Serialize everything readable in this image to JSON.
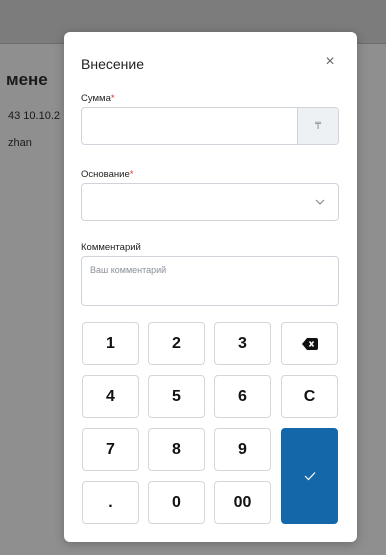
{
  "background": {
    "heading_partial": "мене",
    "line1_partial": "43 10.10.2",
    "line2_partial": "zhan"
  },
  "modal": {
    "title": "Внесение",
    "close_glyph": "×",
    "fields": {
      "amount_label": "Сумма",
      "amount_required": "*",
      "amount_value": "",
      "currency_symbol": "₸",
      "reason_label": "Основание",
      "reason_required": "*",
      "reason_selected": "",
      "comment_label": "Комментарий",
      "comment_placeholder": "Ваш комментарий"
    },
    "keypad": {
      "k1": "1",
      "k2": "2",
      "k3": "3",
      "k4": "4",
      "k5": "5",
      "k6": "6",
      "k7": "7",
      "k8": "8",
      "k9": "9",
      "kdot": ".",
      "k0": "0",
      "k00": "00",
      "clear": "C",
      "backspace_icon": "backspace-icon",
      "submit_icon": "checkmark-icon"
    }
  },
  "colors": {
    "accent": "#1467a8",
    "required": "#e03131",
    "overlay": "#8f8f8f"
  }
}
